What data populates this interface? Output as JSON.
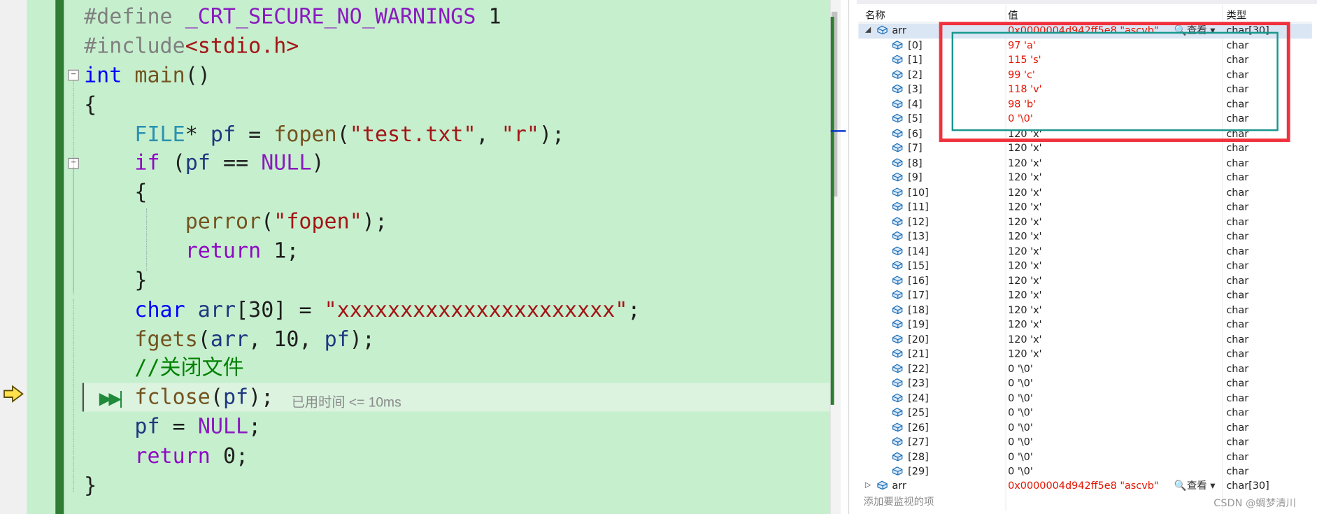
{
  "code": {
    "line1": {
      "pp": "#define",
      "macro": "_CRT_SECURE_NO_WARNINGS",
      "num": "1"
    },
    "line2": {
      "pp": "#include",
      "inc": "<stdio.h>"
    },
    "line3": {
      "kw": "int",
      "fn": "main",
      "rest": "()"
    },
    "line4": {
      "text": "{"
    },
    "line5": {
      "type": "FILE",
      "star": "*",
      "var": "pf",
      "eq": "=",
      "fn": "fopen",
      "p1": "(",
      "s1": "\"test.txt\"",
      "comma": ",",
      "s2": "\"r\"",
      "end": ");"
    },
    "line6": {
      "kw": "if",
      "p1": "(",
      "var": "pf",
      "op": "==",
      "macro": "NULL",
      "p2": ")"
    },
    "line7": {
      "text": "{"
    },
    "line8": {
      "fn": "perror",
      "p1": "(",
      "s": "\"fopen\"",
      "end": ");"
    },
    "line9": {
      "kw": "return",
      "num": "1",
      "end": ";"
    },
    "line10": {
      "text": "}"
    },
    "line11": {
      "kw": "char",
      "var": "arr",
      "dims": "[30]",
      "eq": "=",
      "s": "\"xxxxxxxxxxxxxxxxxxxxxx\"",
      "end": ";"
    },
    "line12": {
      "fn": "fgets",
      "p1": "(",
      "var1": "arr",
      "c1": ",",
      "num": "10",
      "c2": ",",
      "var2": "pf",
      "end": ");"
    },
    "line13": {
      "cmt": "//关闭文件"
    },
    "line14": {
      "fn": "fclose",
      "p1": "(",
      "var": "pf",
      "end": ");"
    },
    "line15": {
      "var": "pf",
      "eq": "=",
      "macro": "NULL",
      "end": ";"
    },
    "line16": {
      "kw": "return",
      "num": "0",
      "end": ";"
    },
    "line17": {
      "text": "}"
    },
    "elapsed": "已用时间 <= 10ms"
  },
  "watch": {
    "headers": {
      "name": "名称",
      "value": "值",
      "type": "类型"
    },
    "view_label": "查看",
    "add_watch": "添加要监视的项",
    "arr_top": {
      "name": "arr",
      "value": "0x0000004d942ff5e8 \"ascvb\"",
      "type": "char[30]"
    },
    "arr_bottom": {
      "name": "arr",
      "value": "0x0000004d942ff5e8 \"ascvb\"",
      "type": "char[30]"
    },
    "elements": [
      {
        "name": "[0]",
        "value": "97 'a'",
        "type": "char",
        "changed": true
      },
      {
        "name": "[1]",
        "value": "115 's'",
        "type": "char",
        "changed": true
      },
      {
        "name": "[2]",
        "value": "99 'c'",
        "type": "char",
        "changed": true
      },
      {
        "name": "[3]",
        "value": "118 'v'",
        "type": "char",
        "changed": true
      },
      {
        "name": "[4]",
        "value": "98 'b'",
        "type": "char",
        "changed": true
      },
      {
        "name": "[5]",
        "value": "0 '\\0'",
        "type": "char",
        "changed": true
      },
      {
        "name": "[6]",
        "value": "120 'x'",
        "type": "char",
        "changed": false
      },
      {
        "name": "[7]",
        "value": "120 'x'",
        "type": "char",
        "changed": false
      },
      {
        "name": "[8]",
        "value": "120 'x'",
        "type": "char",
        "changed": false
      },
      {
        "name": "[9]",
        "value": "120 'x'",
        "type": "char",
        "changed": false
      },
      {
        "name": "[10]",
        "value": "120 'x'",
        "type": "char",
        "changed": false
      },
      {
        "name": "[11]",
        "value": "120 'x'",
        "type": "char",
        "changed": false
      },
      {
        "name": "[12]",
        "value": "120 'x'",
        "type": "char",
        "changed": false
      },
      {
        "name": "[13]",
        "value": "120 'x'",
        "type": "char",
        "changed": false
      },
      {
        "name": "[14]",
        "value": "120 'x'",
        "type": "char",
        "changed": false
      },
      {
        "name": "[15]",
        "value": "120 'x'",
        "type": "char",
        "changed": false
      },
      {
        "name": "[16]",
        "value": "120 'x'",
        "type": "char",
        "changed": false
      },
      {
        "name": "[17]",
        "value": "120 'x'",
        "type": "char",
        "changed": false
      },
      {
        "name": "[18]",
        "value": "120 'x'",
        "type": "char",
        "changed": false
      },
      {
        "name": "[19]",
        "value": "120 'x'",
        "type": "char",
        "changed": false
      },
      {
        "name": "[20]",
        "value": "120 'x'",
        "type": "char",
        "changed": false
      },
      {
        "name": "[21]",
        "value": "120 'x'",
        "type": "char",
        "changed": false
      },
      {
        "name": "[22]",
        "value": "0 '\\0'",
        "type": "char",
        "changed": false
      },
      {
        "name": "[23]",
        "value": "0 '\\0'",
        "type": "char",
        "changed": false
      },
      {
        "name": "[24]",
        "value": "0 '\\0'",
        "type": "char",
        "changed": false
      },
      {
        "name": "[25]",
        "value": "0 '\\0'",
        "type": "char",
        "changed": false
      },
      {
        "name": "[26]",
        "value": "0 '\\0'",
        "type": "char",
        "changed": false
      },
      {
        "name": "[27]",
        "value": "0 '\\0'",
        "type": "char",
        "changed": false
      },
      {
        "name": "[28]",
        "value": "0 '\\0'",
        "type": "char",
        "changed": false
      },
      {
        "name": "[29]",
        "value": "0 '\\0'",
        "type": "char",
        "changed": false
      }
    ]
  },
  "watermark": "CSDN @蜩梦清川",
  "colors": {
    "changed_value": "#e51400",
    "highlight_red": "#f0323c",
    "highlight_teal": "#16968c",
    "code_background": "#c6efce"
  }
}
